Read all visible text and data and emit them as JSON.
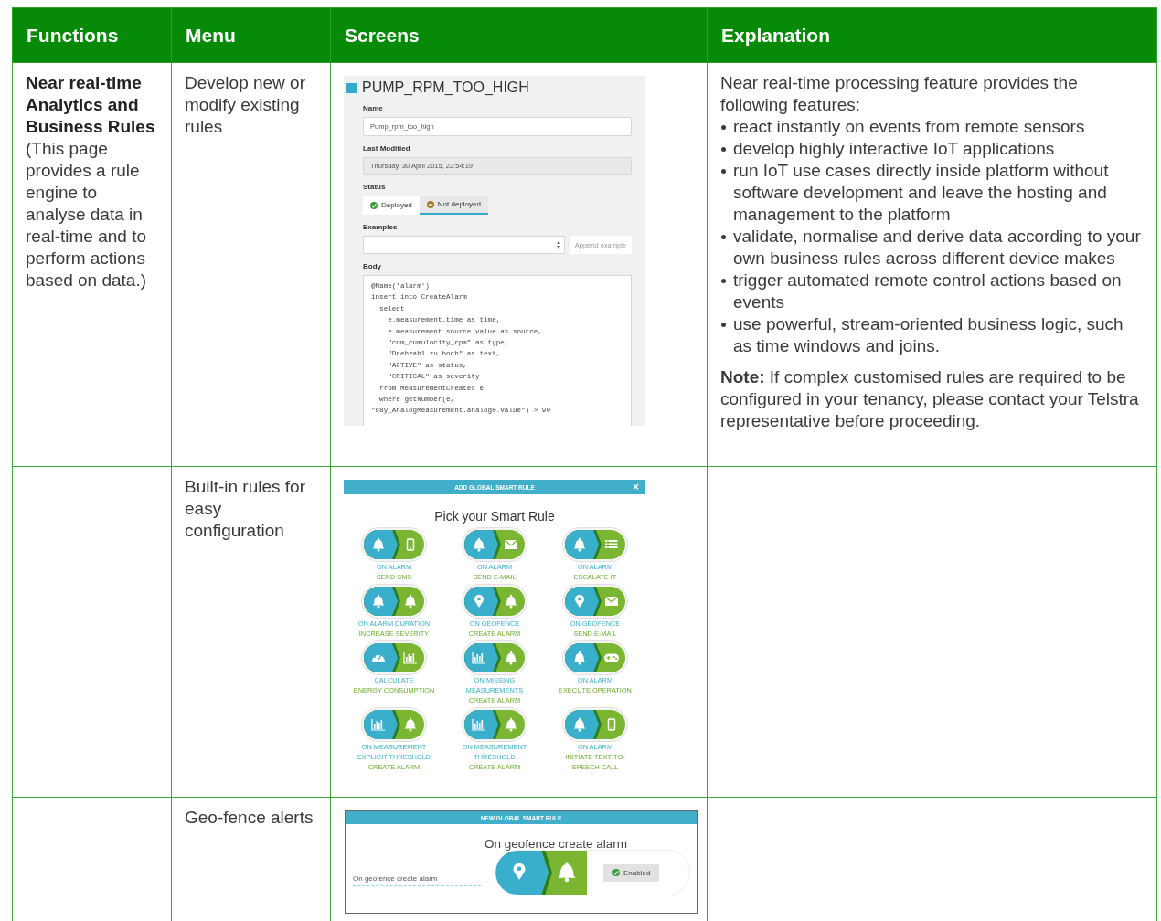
{
  "table": {
    "columns": [
      "Functions",
      "Menu",
      "Screens",
      "Explanation"
    ],
    "rows": [
      {
        "function": {
          "title": "Near real-time Analytics and Business Rules",
          "description": "(This page provides a rule engine to analyse data in real-time and to perform actions based on data.)"
        },
        "menu": "Develop new or modify existing rules",
        "screen": {
          "kind": "rule_editor",
          "title": "PUMP_RPM_TOO_HIGH",
          "fields": [
            {
              "label": "Name",
              "value": "Pump_rpm_too_high",
              "disabled": false
            },
            {
              "label": "Last Modified",
              "value": "Thursday, 30 April 2015, 22:54:19",
              "disabled": true
            }
          ],
          "status": {
            "label": "Status",
            "options": [
              {
                "label": "Deployed",
                "selected": false,
                "kind": "ok"
              },
              {
                "label": "Not deployed",
                "selected": true,
                "kind": "stop"
              }
            ]
          },
          "examples": {
            "label": "Examples",
            "button": "Append example"
          },
          "body": {
            "label": "Body",
            "lines": [
              "@Name('alarm')",
              "insert into CreateAlarm",
              "  select",
              "    e.measurement.time as time,",
              "    e.measurement.source.value as source,",
              "    \"com_cumulocity_rpm\" as type,",
              "    \"Drehzahl zu hoch\" as text,",
              "    \"ACTIVE\" as status,",
              "    \"CRITICAL\" as severity",
              "  from MeasurementCreated e",
              "  where getNumber(e,",
              "\"c8y_AnalogMeasurement.analog0.value\") > 90"
            ]
          }
        },
        "explanation": {
          "intro": "Near real-time processing feature provides the following features:",
          "bullets": [
            "react instantly on events from remote sensors",
            "develop highly interactive IoT applications",
            "run IoT use cases directly inside platform without software development and leave the hosting and management to the platform",
            "validate, normalise and derive data according to your own business rules across different device makes",
            "trigger automated remote control actions based on events",
            "use powerful, stream-oriented business logic, such as time windows and joins."
          ],
          "note": "**Note:** If complex customised rules are required to be configured in your tenancy, please contact your Telstra representative before proceeding."
        }
      },
      {
        "menu": "Built-in rules for easy configuration",
        "screen": {
          "kind": "rule_picker",
          "header": "ADD GLOBAL SMART RULE",
          "close": "×",
          "title": "Pick your Smart Rule",
          "rules": [
            {
              "trigger": {
                "kind": "bell"
              },
              "action": {
                "kind": "phone"
              },
              "lines": [
                {
                  "text": "ON ALARM",
                  "kind": "trigger"
                },
                {
                  "text": "SEND SMS",
                  "kind": "action"
                }
              ]
            },
            {
              "trigger": {
                "kind": "bell"
              },
              "action": {
                "kind": "envelope"
              },
              "lines": [
                {
                  "text": "ON ALARM",
                  "kind": "trigger"
                },
                {
                  "text": "SEND E-MAIL",
                  "kind": "action"
                }
              ]
            },
            {
              "trigger": {
                "kind": "bell"
              },
              "action": {
                "kind": "list"
              },
              "lines": [
                {
                  "text": "ON ALARM",
                  "kind": "trigger"
                },
                {
                  "text": "ESCALATE IT",
                  "kind": "action"
                }
              ]
            },
            {
              "trigger": {
                "kind": "bell"
              },
              "action": {
                "kind": "bell"
              },
              "lines": [
                {
                  "text": "ON ALARM DURATION",
                  "kind": "trigger"
                },
                {
                  "text": "INCREASE SEVERITY",
                  "kind": "action"
                }
              ]
            },
            {
              "trigger": {
                "kind": "pin"
              },
              "action": {
                "kind": "bell"
              },
              "lines": [
                {
                  "text": "ON GEOFENCE",
                  "kind": "trigger"
                },
                {
                  "text": "CREATE ALARM",
                  "kind": "action"
                }
              ]
            },
            {
              "trigger": {
                "kind": "pin"
              },
              "action": {
                "kind": "envelope"
              },
              "lines": [
                {
                  "text": "ON GEOFENCE",
                  "kind": "trigger"
                },
                {
                  "text": "SEND E-MAIL",
                  "kind": "action"
                }
              ]
            },
            {
              "trigger": {
                "kind": "gauge"
              },
              "action": {
                "kind": "chart"
              },
              "lines": [
                {
                  "text": "CALCULATE",
                  "kind": "trigger"
                },
                {
                  "text": "ENERGY CONSUMPTION",
                  "kind": "action"
                }
              ]
            },
            {
              "trigger": {
                "kind": "chart"
              },
              "action": {
                "kind": "bell"
              },
              "lines": [
                {
                  "text": "ON MISSING",
                  "kind": "trigger"
                },
                {
                  "text": "MEASUREMENTS",
                  "kind": "trigger"
                },
                {
                  "text": "CREATE ALARM",
                  "kind": "action"
                }
              ]
            },
            {
              "trigger": {
                "kind": "bell"
              },
              "action": {
                "kind": "gamepad"
              },
              "lines": [
                {
                  "text": "ON ALARM",
                  "kind": "trigger"
                },
                {
                  "text": "EXECUTE OPERATION",
                  "kind": "action"
                }
              ]
            },
            {
              "trigger": {
                "kind": "chart"
              },
              "action": {
                "kind": "bell"
              },
              "lines": [
                {
                  "text": "ON MEASUREMENT",
                  "kind": "trigger"
                },
                {
                  "text": "EXPLICIT THRESHOLD",
                  "kind": "trigger"
                },
                {
                  "text": "CREATE ALARM",
                  "kind": "action"
                }
              ]
            },
            {
              "trigger": {
                "kind": "chart"
              },
              "action": {
                "kind": "bell"
              },
              "lines": [
                {
                  "text": "ON MEASUREMENT",
                  "kind": "trigger"
                },
                {
                  "text": "THRESHOLD",
                  "kind": "trigger"
                },
                {
                  "text": "CREATE ALARM",
                  "kind": "action"
                }
              ]
            },
            {
              "trigger": {
                "kind": "bell"
              },
              "action": {
                "kind": "phone"
              },
              "lines": [
                {
                  "text": "ON ALARM",
                  "kind": "trigger"
                },
                {
                  "text": "INITIATE TEXT-TO-",
                  "kind": "action"
                },
                {
                  "text": "SPEECH CALL",
                  "kind": "action"
                }
              ]
            }
          ]
        }
      },
      {
        "menu": "Geo-fence alerts",
        "screen": {
          "kind": "rule_detail",
          "header": "NEW GLOBAL SMART RULE",
          "title": "On geofence create alarm",
          "name_value": "On geofence create alarm",
          "trigger": {
            "kind": "pin"
          },
          "action": {
            "kind": "bell"
          },
          "toggle": {
            "label": "Enabled",
            "on": true
          }
        }
      }
    ]
  }
}
